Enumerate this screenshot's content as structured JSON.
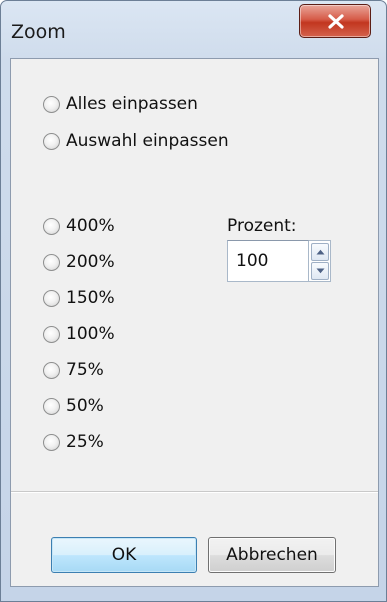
{
  "window": {
    "title": "Zoom"
  },
  "fit_options": [
    {
      "label": "Alles einpassen",
      "selected": false
    },
    {
      "label": "Auswahl einpassen",
      "selected": false
    }
  ],
  "zoom_levels": [
    {
      "label": "400%",
      "selected": false
    },
    {
      "label": "200%",
      "selected": false
    },
    {
      "label": "150%",
      "selected": false
    },
    {
      "label": "100%",
      "selected": false
    },
    {
      "label": "75%",
      "selected": false
    },
    {
      "label": "50%",
      "selected": false
    },
    {
      "label": "25%",
      "selected": false
    }
  ],
  "percent": {
    "label": "Prozent:",
    "value": "100"
  },
  "buttons": {
    "ok_label": "OK",
    "cancel_label": "Abbrechen"
  },
  "colors": {
    "close_button": "#c2361f",
    "ok_button_border": "#3c7fb1",
    "client_background": "#f0f0f0"
  }
}
